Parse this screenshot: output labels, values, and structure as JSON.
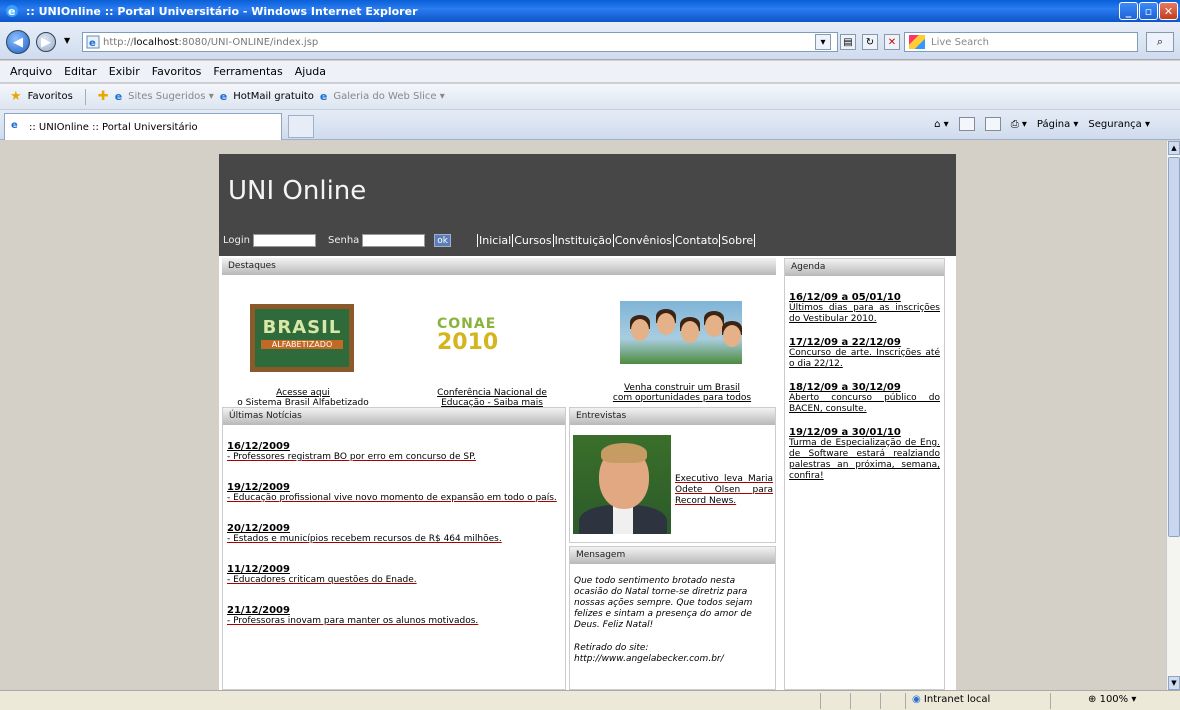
{
  "window": {
    "title": ":: UNIOnline :: Portal Universitário - Windows Internet Explorer",
    "buttons": [
      "_",
      "▫",
      "✕"
    ]
  },
  "address": {
    "url_prefix": "http://",
    "url_host": "localhost",
    "url_rest": ":8080/UNI-ONLINE/index.jsp",
    "search_placeholder": "Live Search"
  },
  "menu": [
    "Arquivo",
    "Editar",
    "Exibir",
    "Favoritos",
    "Ferramentas",
    "Ajuda"
  ],
  "favorites": {
    "label": "Favoritos",
    "items": [
      "Sites Sugeridos ▾",
      "HotMail gratuito",
      "Galeria do Web Slice ▾"
    ]
  },
  "tab": {
    "title": ":: UNIOnline :: Portal Universitário"
  },
  "commands": {
    "page": "Página ▾",
    "security": "Segurança ▾"
  },
  "site": {
    "title": "UNI Online",
    "login_label": "Login",
    "password_label": "Senha",
    "ok_label": "ok",
    "nav": [
      "Inicial",
      "Cursos",
      "Instituição",
      "Convênios",
      "Contato",
      "Sobre"
    ],
    "destaques": {
      "header": "Destaques",
      "items": [
        {
          "badge_line1": "BRASIL",
          "badge_line2": "ALFABETIZADO",
          "caption1": "Acesse aqui",
          "caption2": "o Sistema Brasil Alfabetizado"
        },
        {
          "badge_line1": "CONAE",
          "badge_line2": "2010",
          "caption1": "Conferência Nacional de",
          "caption2": "Educação - Saiba mais"
        },
        {
          "caption1": "Venha construir um Brasil",
          "caption2": "com oportunidades para todos"
        }
      ]
    },
    "agenda": {
      "header": "Agenda",
      "entries": [
        {
          "date": "16/12/09 a 05/01/10",
          "text": "Últimos dias para as inscrições do Vestibular 2010."
        },
        {
          "date": "17/12/09 a 22/12/09",
          "text": "Concurso de arte. Inscrições até o dia 22/12."
        },
        {
          "date": "18/12/09 a 30/12/09",
          "text": "Aberto concurso público do BACEN, consulte."
        },
        {
          "date": "19/12/09 a 30/01/10",
          "text": "Turma de Especialização de Eng. de Software estará realziando palestras an próxima, semana, confira!"
        }
      ]
    },
    "noticias": {
      "header": "Últimas Notícias",
      "entries": [
        {
          "date": "16/12/2009",
          "text": "- Professores registram BO por erro em concurso de SP."
        },
        {
          "date": "19/12/2009",
          "text": "- Educação profissional vive novo momento de expansão em todo o país."
        },
        {
          "date": "20/12/2009",
          "text": "- Estados e municípios recebem recursos de R$ 464 milhões."
        },
        {
          "date": "11/12/2009",
          "text": "- Educadores criticam questões do Enade."
        },
        {
          "date": "21/12/2009",
          "text": "- Professoras inovam para manter os alunos motivados."
        }
      ]
    },
    "entrevistas": {
      "header": "Entrevistas",
      "text": "Executivo leva Maria Odete Olsen para Record News."
    },
    "mensagem": {
      "header": "Mensagem",
      "text": "Que todo sentimento brotado nesta ocasião do Natal torne-se diretriz para nossas ações sempre. Que todos sejam felizes e sintam a presença do amor de Deus. Feliz Natal!",
      "source_label": "Retirado do site:",
      "source_url": "http://www.angelabecker.com.br/"
    }
  },
  "status": {
    "zone": "Intranet local",
    "zoom": "100%"
  }
}
